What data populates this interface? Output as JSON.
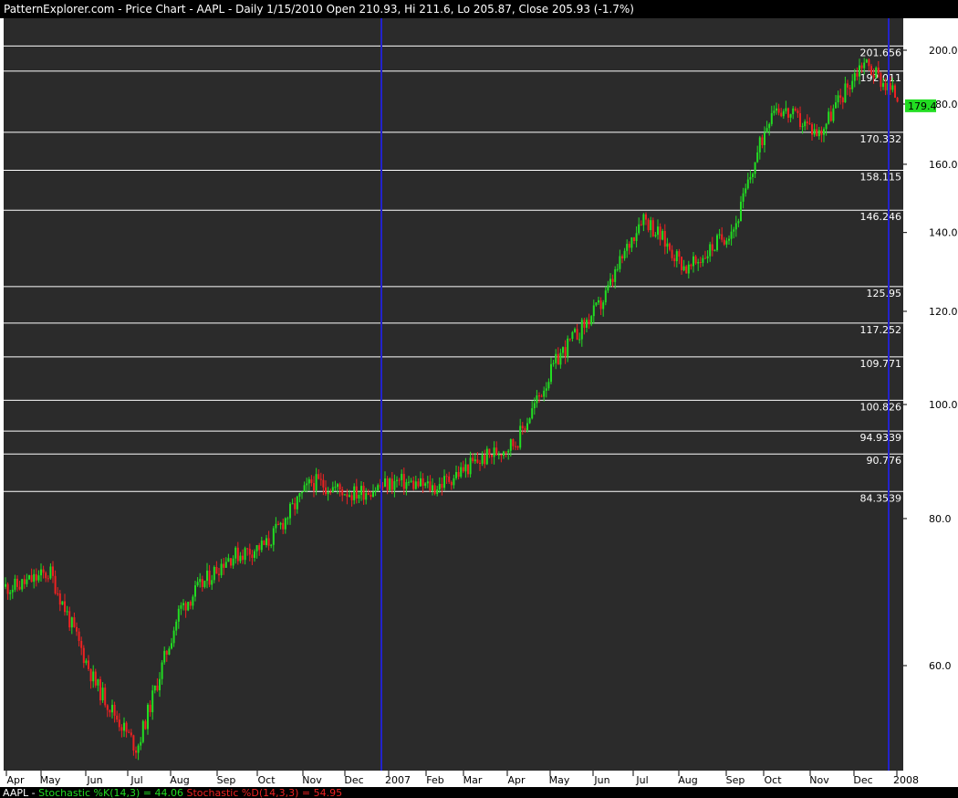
{
  "window": {
    "title": "PatternExplorer.com - Price Chart - AAPL - Daily 1/15/2010 Open 210.93, Hi 211.6, Lo 205.87, Close 205.93 (-1.7%)"
  },
  "colors": {
    "background": "#ffffff",
    "plot_background": "#2b2b2b",
    "up_candle": "#22dd22",
    "down_candle": "#ee2222",
    "level_line": "#ffffff",
    "marker_line": "#2222cc",
    "last_price_bg": "#22dd22"
  },
  "footer": {
    "symbol": "AAPL",
    "k_label": "Stochastic %K(14,3) = 44.06",
    "d_label": "Stochastic %D(14,3,3) = 54.95",
    "k_color": "#22dd22",
    "d_color": "#ee2222"
  },
  "chart_data": {
    "type": "candlestick",
    "title": "PatternExplorer.com - Price Chart - AAPL - Daily",
    "y_scale": "log",
    "ylim": [
      47,
      208
    ],
    "y_ticks": [
      "200.0",
      "180.0",
      "160.0",
      "140.0",
      "120.0",
      "100.0",
      "80.0",
      "60.0"
    ],
    "y_tick_values": [
      200,
      180,
      160,
      140,
      120,
      100,
      80,
      60
    ],
    "x_labels": [
      "Apr",
      "May",
      "Jun",
      "Jul",
      "Aug",
      "Sep",
      "Oct",
      "Nov",
      "Dec",
      "2007",
      "Feb",
      "Mar",
      "Apr",
      "May",
      "Jun",
      "Jul",
      "Aug",
      "Sep",
      "Oct",
      "Nov",
      "Dec",
      "2008"
    ],
    "levels": [
      {
        "label": "201.656",
        "value": 201.656
      },
      {
        "label": "192.011",
        "value": 192.011
      },
      {
        "label": "170.332",
        "value": 170.332
      },
      {
        "label": "158.115",
        "value": 158.115
      },
      {
        "label": "146.246",
        "value": 146.246
      },
      {
        "label": "125.95",
        "value": 125.95
      },
      {
        "label": "117.252",
        "value": 117.252
      },
      {
        "label": "109.771",
        "value": 109.771
      },
      {
        "label": "100.826",
        "value": 100.826
      },
      {
        "label": "94.9339",
        "value": 94.9339
      },
      {
        "label": "90.776",
        "value": 90.776
      },
      {
        "label": "84.3539",
        "value": 84.3539
      }
    ],
    "last_price_label": "179.4",
    "last_price": 179.4,
    "vertical_markers": [
      "2007",
      "2008"
    ],
    "close_path": [
      {
        "month": "Apr",
        "close": 70
      },
      {
        "month": "May",
        "close": 72
      },
      {
        "month": "Jun",
        "close": 58
      },
      {
        "month": "Jul",
        "close": 51
      },
      {
        "month": "Aug",
        "close": 67
      },
      {
        "month": "Sep",
        "close": 74
      },
      {
        "month": "Oct",
        "close": 76
      },
      {
        "month": "Nov",
        "close": 86
      },
      {
        "month": "Dec",
        "close": 84
      },
      {
        "month": "2007",
        "close": 86
      },
      {
        "month": "Feb",
        "close": 85
      },
      {
        "month": "Mar",
        "close": 89
      },
      {
        "month": "Apr",
        "close": 93
      },
      {
        "month": "May",
        "close": 110
      },
      {
        "month": "Jun",
        "close": 122
      },
      {
        "month": "Jul",
        "close": 145
      },
      {
        "month": "Aug",
        "close": 130
      },
      {
        "month": "Sep",
        "close": 142
      },
      {
        "month": "Oct",
        "close": 180
      },
      {
        "month": "Nov",
        "close": 170
      },
      {
        "month": "Dec",
        "close": 196
      },
      {
        "month": "2008",
        "close": 179.4
      }
    ]
  }
}
